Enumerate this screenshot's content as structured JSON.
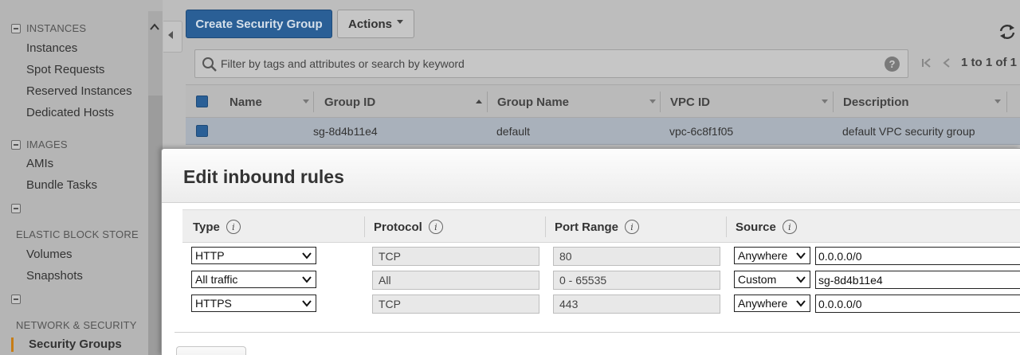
{
  "sidebar": {
    "sections": {
      "instances": "INSTANCES",
      "images": "IMAGES",
      "ebs": "ELASTIC BLOCK STORE",
      "network": "NETWORK & SECURITY"
    },
    "items": {
      "instances": "Instances",
      "spot": "Spot Requests",
      "reserved": "Reserved Instances",
      "dedicated": "Dedicated Hosts",
      "amis": "AMIs",
      "bundle": "Bundle Tasks",
      "volumes": "Volumes",
      "snapshots": "Snapshots",
      "security_groups": "Security Groups"
    }
  },
  "toolbar": {
    "create_label": "Create Security Group",
    "actions_label": "Actions"
  },
  "search": {
    "placeholder": "Filter by tags and attributes or search by keyword",
    "help": "?"
  },
  "pager": {
    "text": "1 to 1 of 1"
  },
  "grid": {
    "columns": [
      "Name",
      "Group ID",
      "Group Name",
      "VPC ID",
      "Description"
    ],
    "rows": [
      {
        "name": "",
        "group_id": "sg-8d4b11e4",
        "group_name": "default",
        "vpc_id": "vpc-6c8f1f05",
        "description": "default VPC security group"
      }
    ]
  },
  "modal": {
    "title": "Edit inbound rules",
    "columns": [
      "Type",
      "Protocol",
      "Port Range",
      "Source"
    ],
    "info_glyph": "i",
    "rules": [
      {
        "type": "HTTP",
        "protocol": "TCP",
        "port_range": "80",
        "source_type": "Anywhere",
        "source": "0.0.0.0/0"
      },
      {
        "type": "All traffic",
        "protocol": "All",
        "port_range": "0 - 65535",
        "source_type": "Custom",
        "source": "sg-8d4b11e4"
      },
      {
        "type": "HTTPS",
        "protocol": "TCP",
        "port_range": "443",
        "source_type": "Anywhere",
        "source": "0.0.0.0/0"
      }
    ]
  },
  "colors": {
    "primary_button": "#2a5f96",
    "active_nav_marker": "#c77c15",
    "overlay_gray": "#bdbdbd"
  },
  "icons": [
    "minus-square-icon",
    "caret-up-icon",
    "collapse-arrow-icon",
    "chevron-down-icon",
    "refresh-icon",
    "search-icon",
    "help-icon",
    "first-page-icon",
    "prev-page-icon",
    "sort-icon",
    "info-icon"
  ]
}
